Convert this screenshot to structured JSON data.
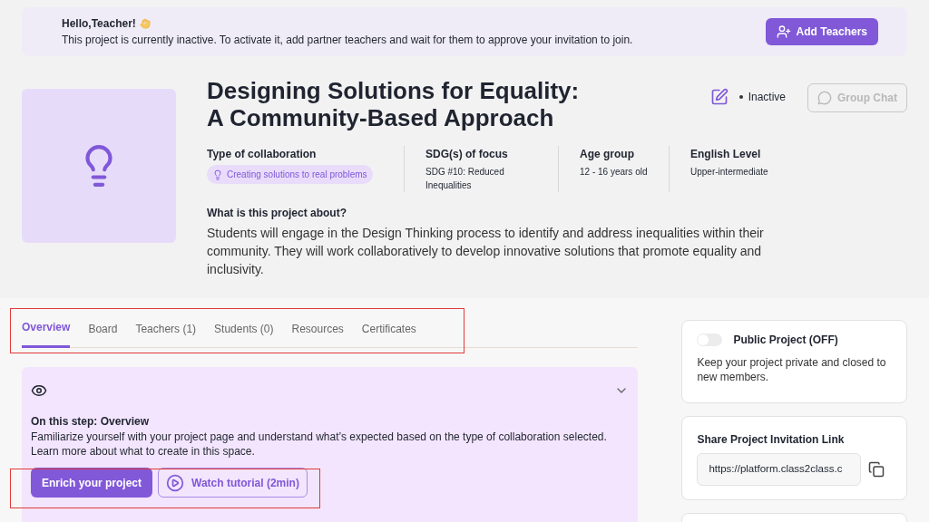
{
  "banner": {
    "greeting": "Hello,Teacher!",
    "message": "This project is currently inactive. To activate it, add partner teachers and wait for them to approve your invitation to join.",
    "button": "Add Teachers"
  },
  "project": {
    "title": "Designing Solutions for Equality: A Community-Based Approach",
    "status": {
      "label": "Inactive",
      "active": false
    },
    "group_chat": {
      "label": "Group Chat",
      "disabled": true
    },
    "facts": [
      {
        "label": "Type of collaboration",
        "value": "Creating solutions to real problems",
        "kind": "chip"
      },
      {
        "label": "SDG(s) of focus",
        "value": "SDG #10: Reduced Inequalities",
        "kind": "text"
      },
      {
        "label": "Age group",
        "value": "12 - 16 years old",
        "kind": "text"
      },
      {
        "label": "English Level",
        "value": "Upper-intermediate",
        "kind": "text"
      }
    ],
    "about_heading": "What is this project about?",
    "about": "Students will engage in the Design Thinking process to identify and address inequalities within their community. They will work collaboratively to develop innovative solutions that promote equality and inclusivity."
  },
  "tabs": [
    {
      "label": "Overview",
      "selected": true
    },
    {
      "label": "Board",
      "selected": false
    },
    {
      "label": "Teachers (1)",
      "selected": false
    },
    {
      "label": "Students (0)",
      "selected": false
    },
    {
      "label": "Resources",
      "selected": false
    },
    {
      "label": "Certificates",
      "selected": false
    }
  ],
  "step": {
    "heading": "On this step: Overview",
    "text": "Familiarize yourself with your project page and understand what’s expected based on the type of collaboration selected. Learn more about what to create in this space.",
    "expanded": false,
    "primary_button": "Enrich your project",
    "tutorial_button": "Watch tutorial (2min)"
  },
  "public": {
    "label": "Public Project (OFF)",
    "on": false,
    "description": "Keep your project private and closed to new members."
  },
  "share": {
    "heading": "Share Project Invitation Link",
    "value": "https://platform.class2class.c"
  }
}
